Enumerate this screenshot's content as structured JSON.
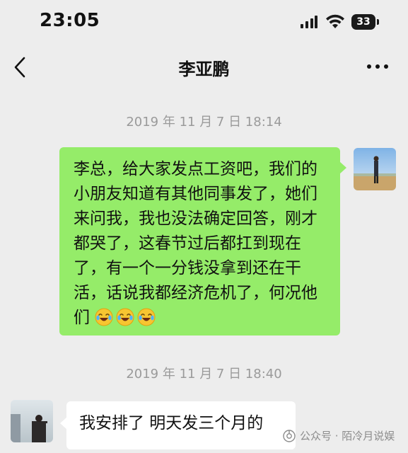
{
  "status_bar": {
    "time": "23:05",
    "battery_level": "33",
    "signal_icon": "cellular-signal-icon",
    "wifi_icon": "wifi-icon"
  },
  "nav": {
    "title": "李亚鹏",
    "back_icon": "chevron-left-icon",
    "more_icon": "more-dots-icon"
  },
  "messages": [
    {
      "timestamp": "2019 年 11 月 7 日  18:14",
      "direction": "outgoing",
      "text": "李总，给大家发点工资吧，我们的小朋友知道有其他同事发了，她们来问我，我也没法确定回答，刚才都哭了，这春节过后都扛到现在了，有一个一分钱没拿到还在干活，话说我都经济危机了，何况他们",
      "emoji": [
        "laughing-crying-emoji",
        "laughing-crying-emoji",
        "laughing-crying-emoji"
      ]
    },
    {
      "timestamp": "2019 年 11 月 7 日  18:40",
      "direction": "incoming",
      "text": "我安排了 明天发三个月的"
    }
  ],
  "watermark": {
    "text": "公众号 · 陌冷月说娱",
    "icon": "wechat-official-account-icon"
  },
  "colors": {
    "background": "#ededed",
    "outgoing_bubble": "#95ec69",
    "incoming_bubble": "#ffffff",
    "timestamp_text": "#9a9a9a"
  }
}
